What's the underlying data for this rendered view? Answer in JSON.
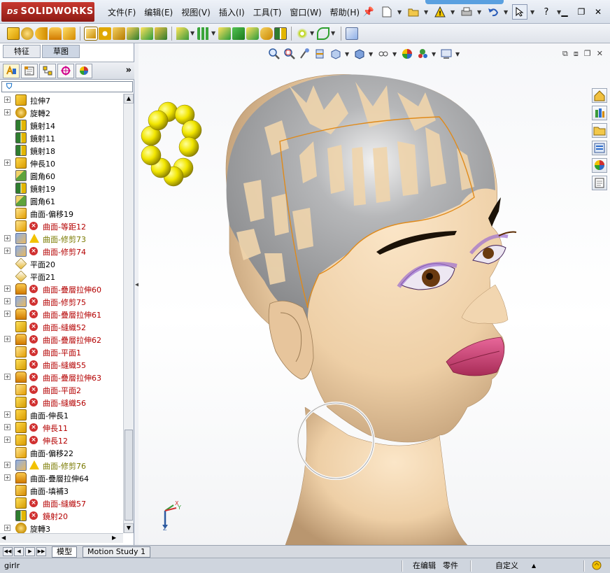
{
  "app": {
    "logo_text": "SOLIDWORKS",
    "logo_prefix": "DS"
  },
  "menu": [
    "文件(F)",
    "编辑(E)",
    "视图(V)",
    "插入(I)",
    "工具(T)",
    "窗口(W)",
    "帮助(H)"
  ],
  "quick_access": [
    {
      "icon": "pin-icon"
    },
    {
      "icon": "new-document-icon"
    },
    {
      "icon": "open-folder-icon"
    },
    {
      "icon": "rebuild-warning-icon"
    },
    {
      "icon": "print-icon"
    },
    {
      "icon": "undo-icon"
    },
    {
      "icon": "select-pointer-icon"
    },
    {
      "icon": "help-icon",
      "label": "?"
    }
  ],
  "panel_tabs": [
    {
      "label": "特征"
    },
    {
      "label": "草图"
    }
  ],
  "manager_tabs": [
    "feature-manager-icon",
    "property-manager-icon",
    "configuration-manager-icon",
    "dimxpert-icon",
    "display-manager-icon"
  ],
  "tree": [
    {
      "label": "拉伸7",
      "icon": "ext",
      "expand": true,
      "state": "ok"
    },
    {
      "label": "旋轉2",
      "icon": "rev",
      "expand": true,
      "state": "ok"
    },
    {
      "label": "鏡射14",
      "icon": "mir",
      "expand": false,
      "state": "ok"
    },
    {
      "label": "鏡射11",
      "icon": "mir",
      "expand": false,
      "state": "ok"
    },
    {
      "label": "鏡射18",
      "icon": "mir",
      "expand": false,
      "state": "ok"
    },
    {
      "label": "伸長10",
      "icon": "ext",
      "expand": true,
      "state": "ok"
    },
    {
      "label": "圓角60",
      "icon": "fil",
      "expand": false,
      "state": "ok"
    },
    {
      "label": "鏡射19",
      "icon": "mir",
      "expand": false,
      "state": "ok"
    },
    {
      "label": "圓角61",
      "icon": "fil",
      "expand": false,
      "state": "ok"
    },
    {
      "label": "曲面-偏移19",
      "icon": "srf",
      "expand": false,
      "state": "ok"
    },
    {
      "label": "曲面-等距12",
      "icon": "srf",
      "expand": false,
      "state": "error"
    },
    {
      "label": "曲面-修剪73",
      "icon": "trm",
      "expand": true,
      "state": "warn"
    },
    {
      "label": "曲面-修剪74",
      "icon": "trm",
      "expand": true,
      "state": "error"
    },
    {
      "label": "平面20",
      "icon": "pln",
      "expand": false,
      "state": "ok"
    },
    {
      "label": "平面21",
      "icon": "pln",
      "expand": false,
      "state": "ok"
    },
    {
      "label": "曲面-疊層拉伸60",
      "icon": "lft",
      "expand": true,
      "state": "error"
    },
    {
      "label": "曲面-修剪75",
      "icon": "trm",
      "expand": true,
      "state": "error"
    },
    {
      "label": "曲面-疊層拉伸61",
      "icon": "lft",
      "expand": true,
      "state": "error"
    },
    {
      "label": "曲面-縫織52",
      "icon": "knt",
      "expand": false,
      "state": "error"
    },
    {
      "label": "曲面-疊層拉伸62",
      "icon": "lft",
      "expand": true,
      "state": "error"
    },
    {
      "label": "曲面-平面1",
      "icon": "srf",
      "expand": false,
      "state": "error"
    },
    {
      "label": "曲面-縫織55",
      "icon": "knt",
      "expand": false,
      "state": "error"
    },
    {
      "label": "曲面-疊層拉伸63",
      "icon": "lft",
      "expand": true,
      "state": "error"
    },
    {
      "label": "曲面-平面2",
      "icon": "srf",
      "expand": false,
      "state": "error"
    },
    {
      "label": "曲面-縫織56",
      "icon": "knt",
      "expand": false,
      "state": "error"
    },
    {
      "label": "曲面-伸長1",
      "icon": "ext",
      "expand": true,
      "state": "ok"
    },
    {
      "label": "伸長11",
      "icon": "ext",
      "expand": true,
      "state": "error"
    },
    {
      "label": "伸長12",
      "icon": "ext",
      "expand": true,
      "state": "error"
    },
    {
      "label": "曲面-偏移22",
      "icon": "srf",
      "expand": false,
      "state": "ok"
    },
    {
      "label": "曲面-修剪76",
      "icon": "trm",
      "expand": true,
      "state": "warn"
    },
    {
      "label": "曲面-疊層拉伸64",
      "icon": "lft",
      "expand": true,
      "state": "ok"
    },
    {
      "label": "曲面-填補3",
      "icon": "bnd",
      "expand": false,
      "state": "ok"
    },
    {
      "label": "曲面-縫織57",
      "icon": "knt",
      "expand": false,
      "state": "error"
    },
    {
      "label": "鏡射20",
      "icon": "mir",
      "expand": false,
      "state": "error"
    },
    {
      "label": "旋轉3",
      "icon": "rev",
      "expand": true,
      "state": "ok"
    }
  ],
  "sheet_tabs": [
    {
      "label": "模型",
      "active": true
    },
    {
      "label": "Motion Study 1",
      "active": false
    }
  ],
  "status": {
    "file": "girlr",
    "mode": "在编辑",
    "doc_type": "零件",
    "units": "自定义"
  },
  "triad": {
    "x": "X",
    "y": "Y",
    "z": "Z"
  },
  "colors": {
    "error": "#d03030",
    "warn": "#f2c200",
    "skin": "#f0d7b2",
    "hair_gray": "#a9abad",
    "lips": "#d6497a",
    "earring": "#f4f4f4",
    "beads": "#f2e600"
  }
}
